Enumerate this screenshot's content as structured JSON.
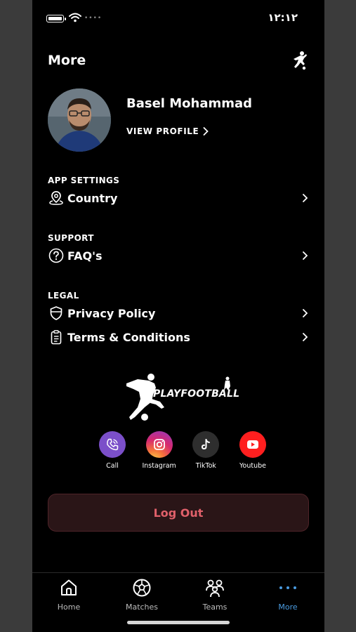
{
  "status_bar": {
    "time": "١٢:١٢",
    "battery_level": 0.9
  },
  "header": {
    "title": "More"
  },
  "profile": {
    "name": "Basel Mohammad",
    "view_profile_label": "VIEW PROFILE"
  },
  "sections": {
    "app_settings": {
      "label": "APP SETTINGS",
      "items": [
        {
          "label": "Country",
          "icon": "location-icon"
        }
      ]
    },
    "support": {
      "label": "SUPPORT",
      "items": [
        {
          "label": "FAQ's",
          "icon": "question-circle-icon"
        }
      ]
    },
    "legal": {
      "label": "LEGAL",
      "items": [
        {
          "label": "Privacy Policy",
          "icon": "shield-icon"
        },
        {
          "label": "Terms & Conditions",
          "icon": "clipboard-icon"
        }
      ]
    }
  },
  "brand": {
    "name": "PLAYFOOTBALL"
  },
  "socials": [
    {
      "label": "Call",
      "icon": "phone-icon",
      "color": "#7b4fc9"
    },
    {
      "label": "Instagram",
      "icon": "instagram-icon",
      "color": "#d6296f"
    },
    {
      "label": "TikTok",
      "icon": "tiktok-icon",
      "color": "#2e2e2e"
    },
    {
      "label": "Youtube",
      "icon": "youtube-icon",
      "color": "#ff1f1f"
    }
  ],
  "logout": {
    "label": "Log Out",
    "color": "#e0606a"
  },
  "tabbar": {
    "active": "More",
    "accent": "#4a9be0",
    "tabs": [
      {
        "label": "Home",
        "icon": "home-icon"
      },
      {
        "label": "Matches",
        "icon": "football-icon"
      },
      {
        "label": "Teams",
        "icon": "team-icon"
      },
      {
        "label": "More",
        "icon": "more-dots-icon"
      }
    ]
  }
}
